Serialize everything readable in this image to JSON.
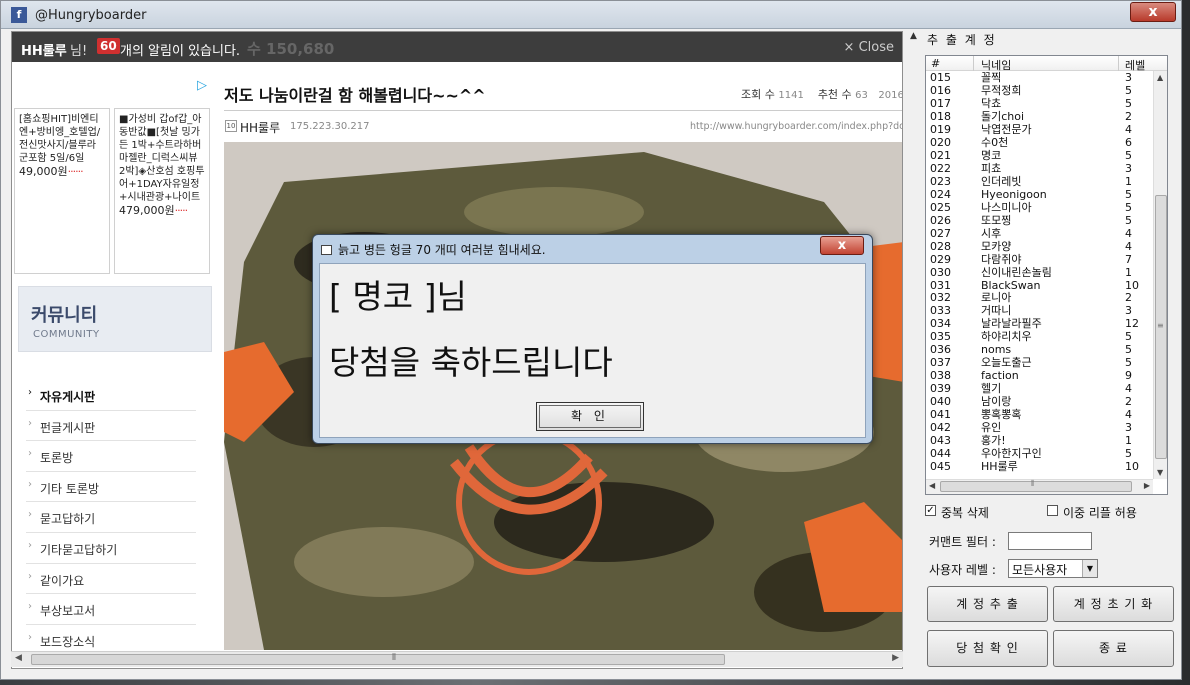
{
  "window": {
    "title": "@Hungryboarder",
    "close": "x"
  },
  "browser": {
    "notification": {
      "user": "HH룰루",
      "honorific": "님!",
      "count": "60",
      "message": "개의 알림이 있습니다.",
      "ghost_text": "수 150,680",
      "close": "× Close"
    },
    "ads": [
      {
        "text": "[홈쇼핑HIT]비엔티엔+방비엥_호텔업/전신맛사지/블루라군포함 5일/6일",
        "price": "49,000원"
      },
      {
        "text": "■가성비 갑of갑_아동반값■[첫날 밍가든 1박+수트라하버 마젤란_디럭스씨뷰 2박]◈산호섬 호핑투어+1DAY자유일정+시내관광+나이트",
        "price": "479,000원"
      }
    ],
    "ad_choice_icon": "▷",
    "community": {
      "korean": "커뮤니티",
      "english": "COMMUNITY"
    },
    "menu": [
      "자유게시판",
      "펀글게시판",
      "토론방",
      "기타 토론방",
      "묻고답하기",
      "기타묻고답하기",
      "같이가요",
      "부상보고서",
      "보드장소식"
    ],
    "post": {
      "title": "저도 나눔이란걸 함 해볼렵니다~~^^",
      "views_label": "조회 수",
      "views": "1141",
      "likes_label": "추천 수",
      "likes": "63",
      "date": "2016.",
      "author_badge": "10",
      "author": "HH룰루",
      "ip": "175.223.30.217",
      "url": "http://www.hungryboarder.com/index.php?document"
    }
  },
  "right_panel": {
    "title": "추 출 계 정",
    "columns": [
      "#",
      "닉네임",
      "레벨"
    ],
    "rows": [
      [
        "015",
        "꼴찍",
        "3"
      ],
      [
        "016",
        "무적정희",
        "5"
      ],
      [
        "017",
        "닥쵸",
        "5"
      ],
      [
        "018",
        "돌기choi",
        "2"
      ],
      [
        "019",
        "낙엽전문가",
        "4"
      ],
      [
        "020",
        "수0천",
        "6"
      ],
      [
        "021",
        "명코",
        "5"
      ],
      [
        "022",
        "피쵸",
        "3"
      ],
      [
        "023",
        "인더레빗",
        "1"
      ],
      [
        "024",
        "Hyeonigoon",
        "5"
      ],
      [
        "025",
        "나스미니아",
        "5"
      ],
      [
        "026",
        "또모찡",
        "5"
      ],
      [
        "027",
        "시후",
        "4"
      ],
      [
        "028",
        "모카양",
        "4"
      ],
      [
        "029",
        "다람쥐야",
        "7"
      ],
      [
        "030",
        "신이내린손놀림",
        "1"
      ],
      [
        "031",
        "BlackSwan",
        "10"
      ],
      [
        "032",
        "로니아",
        "2"
      ],
      [
        "033",
        "거따니",
        "3"
      ],
      [
        "034",
        "날라날라필주",
        "12"
      ],
      [
        "035",
        "하야리치우",
        "5"
      ],
      [
        "036",
        "noms",
        "5"
      ],
      [
        "037",
        "오늘도출근",
        "5"
      ],
      [
        "038",
        "faction",
        "9"
      ],
      [
        "039",
        "헬기",
        "4"
      ],
      [
        "040",
        "남이랑",
        "2"
      ],
      [
        "041",
        "뽕혹뽕혹",
        "4"
      ],
      [
        "042",
        "유인",
        "3"
      ],
      [
        "043",
        "홍가!",
        "1"
      ],
      [
        "044",
        "우아한지구인",
        "5"
      ],
      [
        "045",
        "HH룰루",
        "10"
      ]
    ],
    "dedupe_label": "중복 삭제",
    "dedupe_checked": true,
    "double_reply_label": "이중 리플 허용",
    "double_reply_checked": false,
    "comment_filter_label": "커맨트 필터 :",
    "comment_filter_value": "",
    "user_level_label": "사용자 레벨 :",
    "user_level_value": "모든사용자",
    "buttons": {
      "extract": "계 정 추 출",
      "reset": "계 정 초 기 화",
      "confirm_win": "당 첨 확 인",
      "exit": "종 료"
    }
  },
  "dialog": {
    "title": "늙고 병든 헝글 70 개띠 여러분 힘내세요.",
    "close": "x",
    "line1": "[ 명코 ]님",
    "line2": "당첨을 축하드립니다",
    "ok": "확 인"
  }
}
